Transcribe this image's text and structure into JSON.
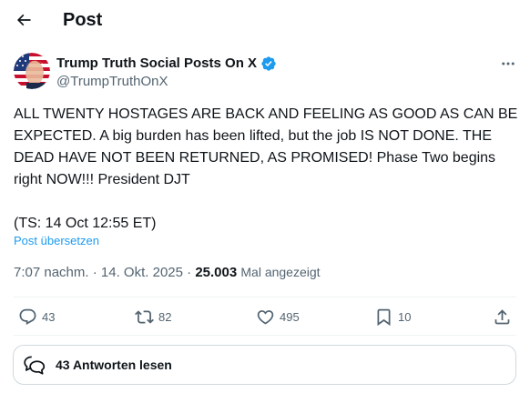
{
  "header": {
    "title": "Post"
  },
  "author": {
    "name": "Trump Truth Social Posts On X",
    "handle": "@TrumpTruthOnX",
    "verified_color": "#1d9bf0"
  },
  "post": {
    "text": "ALL TWENTY HOSTAGES ARE BACK AND FEELING AS GOOD AS CAN BE EXPECTED. A big burden has been lifted, but the job IS NOT DONE. THE DEAD HAVE NOT BEEN RETURNED, AS PROMISED! Phase Two begins right NOW!!! President DJT\n\n(TS: 14 Oct 12:55 ET)",
    "translate_label": "Post übersetzen"
  },
  "meta": {
    "time": "7:07 nachm.",
    "separator": "·",
    "date": "14. Okt. 2025",
    "views_count": "25.003",
    "views_label": "Mal angezeigt"
  },
  "actions": {
    "replies": "43",
    "reposts": "82",
    "likes": "495",
    "bookmarks": "10"
  },
  "replies_button": {
    "label": "43 Antworten lesen"
  },
  "colors": {
    "text": "#0f1419",
    "secondary": "#536471",
    "accent": "#1d9bf0",
    "border": "#cfd9de"
  }
}
